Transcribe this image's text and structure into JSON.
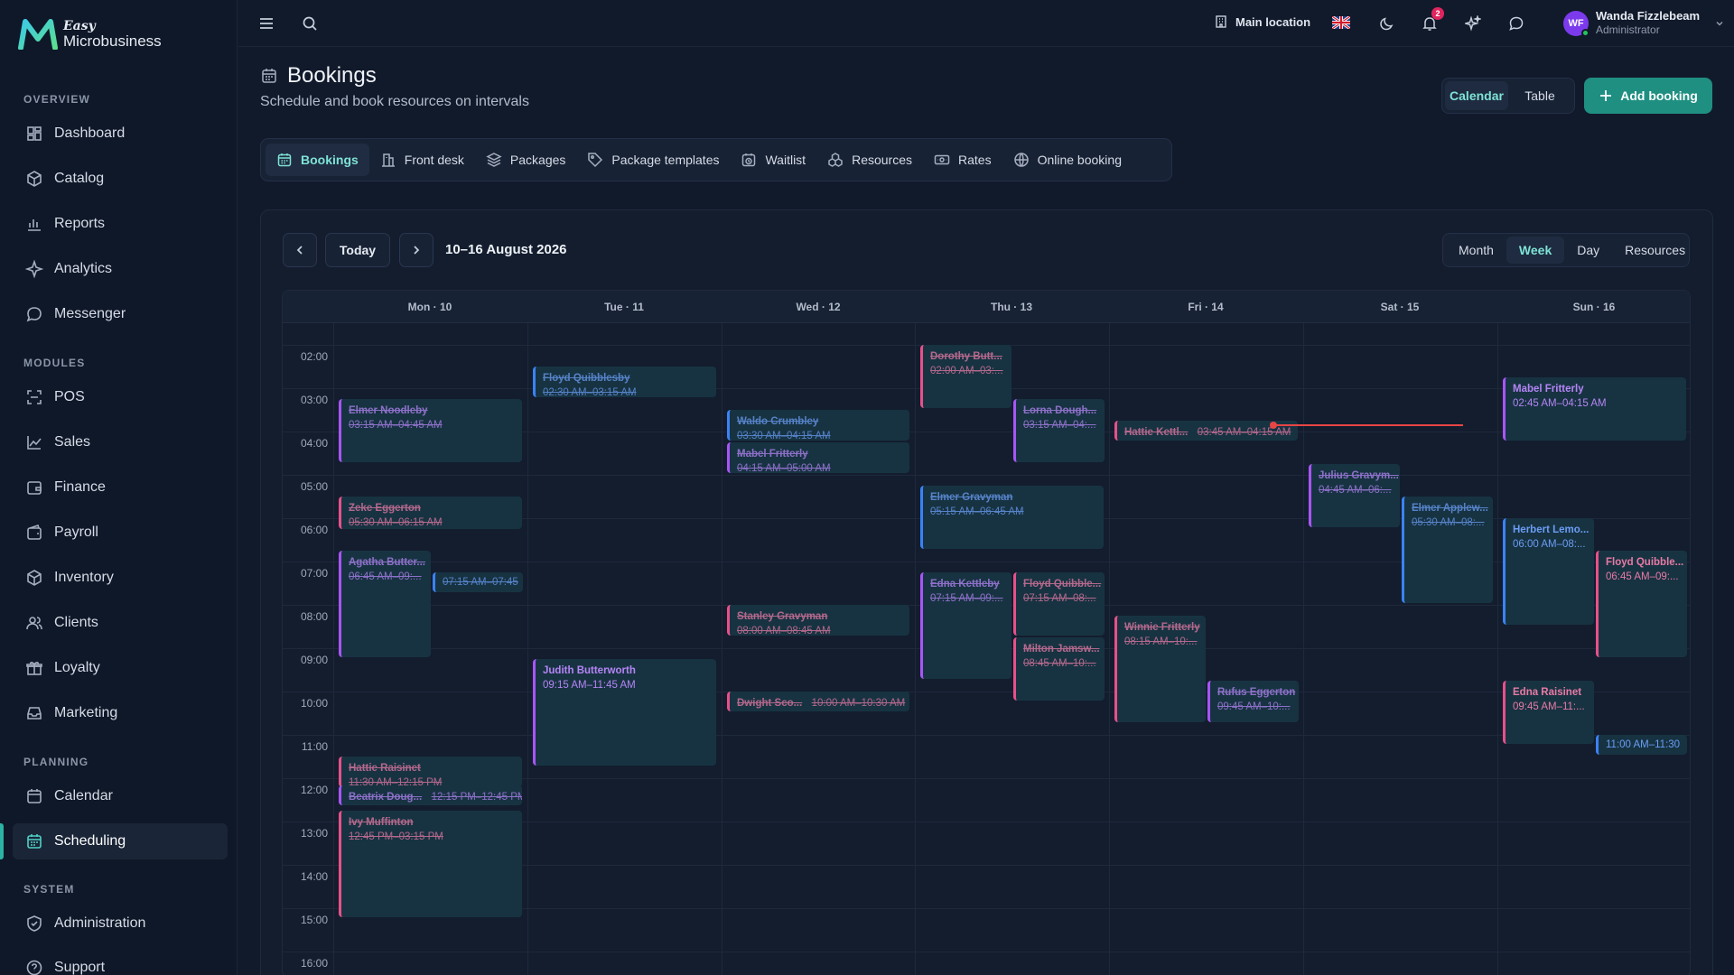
{
  "brand": {
    "easy": "Easy",
    "name": "Microbusiness"
  },
  "sidebar": {
    "sections": {
      "overview": "OVERVIEW",
      "modules": "MODULES",
      "planning": "PLANNING",
      "system": "SYSTEM"
    },
    "items": {
      "dashboard": "Dashboard",
      "catalog": "Catalog",
      "reports": "Reports",
      "analytics": "Analytics",
      "messenger": "Messenger",
      "pos": "POS",
      "sales": "Sales",
      "finance": "Finance",
      "payroll": "Payroll",
      "inventory": "Inventory",
      "clients": "Clients",
      "loyalty": "Loyalty",
      "marketing": "Marketing",
      "calendar": "Calendar",
      "scheduling": "Scheduling",
      "administration": "Administration",
      "support": "Support"
    },
    "active": "Scheduling"
  },
  "topbar": {
    "location": "Main location",
    "notifications_count": "2",
    "user": {
      "initials": "WF",
      "name": "Wanda Fizzlebeam",
      "role": "Administrator"
    }
  },
  "header": {
    "title": "Bookings",
    "subtitle": "Schedule and book resources on intervals",
    "view_toggle": {
      "calendar": "Calendar",
      "table": "Table",
      "active": "Calendar"
    },
    "add_button": "Add booking"
  },
  "tabs": {
    "bookings": "Bookings",
    "front_desk": "Front desk",
    "packages": "Packages",
    "package_templates": "Package templates",
    "waitlist": "Waitlist",
    "resources": "Resources",
    "rates": "Rates",
    "online_booking": "Online booking",
    "active": "Bookings"
  },
  "calendar": {
    "today_label": "Today",
    "range": "10–16 August 2026",
    "views": {
      "month": "Month",
      "week": "Week",
      "day": "Day",
      "resources": "Resources",
      "active": "Week"
    },
    "days": [
      "Mon · 10",
      "Tue · 11",
      "Wed · 12",
      "Thu · 13",
      "Fri · 14",
      "Sat · 15",
      "Sun · 16"
    ],
    "times": [
      "02:00",
      "03:00",
      "04:00",
      "05:00",
      "06:00",
      "07:00",
      "08:00",
      "09:00",
      "10:00",
      "11:00",
      "12:00",
      "13:00",
      "14:00",
      "15:00",
      "16:00"
    ],
    "events": [
      {
        "name": "Elmer Noodleby",
        "time": "03:15 AM–04:45 AM",
        "color": "purple",
        "status": "cancelled"
      },
      {
        "name": "Zeke Eggerton",
        "time": "05:30 AM–06:15 AM",
        "color": "pink",
        "status": "cancelled"
      },
      {
        "name": "Agatha Butter...",
        "time": "06:45 AM–09:...",
        "color": "purple",
        "status": "cancelled"
      },
      {
        "name": "",
        "time": "07:15 AM–07:45",
        "color": "blue",
        "status": "cancelled"
      },
      {
        "name": "Hattie Raisinet",
        "time": "11:30 AM–12:15 PM",
        "color": "pink",
        "status": "cancelled"
      },
      {
        "name": "Beatrix Doug...",
        "time": "12:15 PM–12:45 PM",
        "color": "purple",
        "status": "cancelled"
      },
      {
        "name": "Ivy Muffinton",
        "time": "12:45 PM–03:15 PM",
        "color": "pink",
        "status": "cancelled"
      },
      {
        "name": "Floyd Quibblesby",
        "time": "02:30 AM–03:15 AM",
        "color": "blue",
        "status": "cancelled"
      },
      {
        "name": "Judith Butterworth",
        "time": "09:15 AM–11:45 AM",
        "color": "purple",
        "status": "active"
      },
      {
        "name": "Waldo Crumbley",
        "time": "03:30 AM–04:15 AM",
        "color": "blue",
        "status": "cancelled"
      },
      {
        "name": "Mabel Fritterly",
        "time": "04:15 AM–05:00 AM",
        "color": "purple",
        "status": "cancelled"
      },
      {
        "name": "Stanley Gravyman",
        "time": "08:00 AM–08:45 AM",
        "color": "pink",
        "status": "cancelled"
      },
      {
        "name": "Dwight Sco...",
        "time": "10:00 AM–10:30 AM",
        "color": "pink",
        "status": "cancelled"
      },
      {
        "name": "Dorothy Butt...",
        "time": "02:00 AM–03:...",
        "color": "pink",
        "status": "cancelled"
      },
      {
        "name": "Lorna Dough...",
        "time": "03:15 AM–04:...",
        "color": "purple",
        "status": "cancelled"
      },
      {
        "name": "Elmer Gravyman",
        "time": "05:15 AM–06:45 AM",
        "color": "blue",
        "status": "cancelled"
      },
      {
        "name": "Edna Kettleby",
        "time": "07:15 AM–09:...",
        "color": "purple",
        "status": "cancelled"
      },
      {
        "name": "Floyd Quibble...",
        "time": "07:15 AM–08:...",
        "color": "pink",
        "status": "cancelled"
      },
      {
        "name": "Milton Jamsw...",
        "time": "08:45 AM–10:...",
        "color": "pink",
        "status": "cancelled"
      },
      {
        "name": "Hattie Kettl...",
        "time": "03:45 AM–04:15 AM",
        "color": "pink",
        "status": "cancelled"
      },
      {
        "name": "Winnie Fritterly",
        "time": "08:15 AM–10:...",
        "color": "pink",
        "status": "cancelled"
      },
      {
        "name": "Rufus Eggerton",
        "time": "09:45 AM–10:...",
        "color": "purple",
        "status": "cancelled"
      },
      {
        "name": "Julius Gravym...",
        "time": "04:45 AM–06:...",
        "color": "purple",
        "status": "cancelled"
      },
      {
        "name": "Elmer Applew...",
        "time": "05:30 AM–08:...",
        "color": "blue",
        "status": "cancelled"
      },
      {
        "name": "Mabel Fritterly",
        "time": "02:45 AM–04:15 AM",
        "color": "purple",
        "status": "active"
      },
      {
        "name": "Herbert Lemo...",
        "time": "06:00 AM–08:...",
        "color": "blue",
        "status": "active"
      },
      {
        "name": "Floyd Quibble...",
        "time": "06:45 AM–09:...",
        "color": "pink",
        "status": "active"
      },
      {
        "name": "Edna Raisinet",
        "time": "09:45 AM–11:...",
        "color": "pink",
        "status": "active"
      },
      {
        "name": "",
        "time": "11:00 AM–11:30",
        "color": "blue",
        "status": "active"
      }
    ]
  },
  "colors": {
    "accent": "#2bb3a3",
    "purple": "#a855f7",
    "pink": "#e8508a",
    "blue": "#3b82f6",
    "now_line": "#e84545"
  }
}
